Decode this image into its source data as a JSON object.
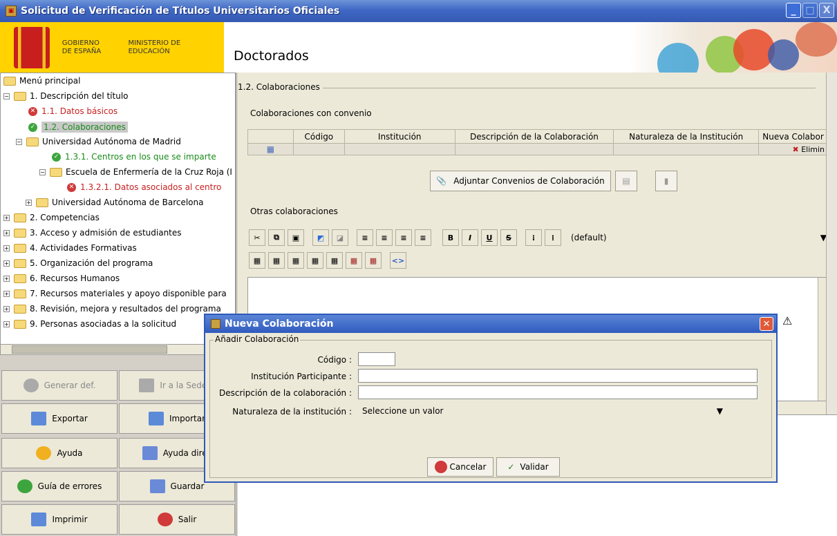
{
  "window": {
    "title": "Solicitud de Verificación de Títulos Universitarios Oficiales",
    "minimize": "_",
    "close": "X"
  },
  "header": {
    "gobierno": "GOBIERNO DE ESPAÑA",
    "ministerio": "MINISTERIO DE EDUCACIÓN",
    "section_title": "Doctorados"
  },
  "tree": {
    "root": "Menú principal",
    "items": [
      {
        "label": "1. Descripción del título"
      },
      {
        "label": "1.1. Datos básicos"
      },
      {
        "label": "1.2. Colaboraciones"
      },
      {
        "label": "Universidad Autónoma de Madrid"
      },
      {
        "label": "1.3.1. Centros en los que se imparte"
      },
      {
        "label": "Escuela de Enfermería de la Cruz Roja (I"
      },
      {
        "label": "1.3.2.1. Datos asociados al centro"
      },
      {
        "label": "Universidad Autónoma de Barcelona"
      },
      {
        "label": "2. Competencias"
      },
      {
        "label": "3. Acceso y admisión de estudiantes"
      },
      {
        "label": "4. Actividades Formativas"
      },
      {
        "label": "5. Organización del programa"
      },
      {
        "label": "6. Recursos Humanos"
      },
      {
        "label": "7. Recursos materiales y apoyo disponible para"
      },
      {
        "label": "8. Revisión, mejora y resultados del programa"
      },
      {
        "label": "9. Personas asociadas a la solicitud"
      }
    ]
  },
  "buttons": {
    "generar": "Generar def.",
    "sede": "Ir a la Sede E",
    "exportar": "Exportar",
    "importar": "Importar",
    "ayuda": "Ayuda",
    "ayuda_directa": "Ayuda direc",
    "guia": "Guía de errores",
    "guardar": "Guardar",
    "imprimir": "Imprimir",
    "salir": "Salir"
  },
  "main": {
    "group_title": "1.2. Colaboraciones",
    "convenio_title": "Colaboraciones con convenio",
    "columns": [
      "",
      "Código",
      "Institución",
      "Descripción de la Colaboración",
      "Naturaleza de la Institución",
      "Nueva Colabor"
    ],
    "row_action": "Elimin",
    "adjuntar": "Adjuntar Convenios de Colaboración",
    "otras_title": "Otras colaboraciones",
    "style_select": "(default)"
  },
  "dialog": {
    "title": "Nueva Colaboración",
    "group": "Añadir Colaboración",
    "codigo_label": "Código :",
    "institucion_label": "Institución Participante :",
    "descripcion_label": "Descripción de la colaboración :",
    "naturaleza_label": "Naturaleza de la institución :",
    "naturaleza_value": "Seleccione un valor",
    "cancelar": "Cancelar",
    "validar": "Validar"
  }
}
